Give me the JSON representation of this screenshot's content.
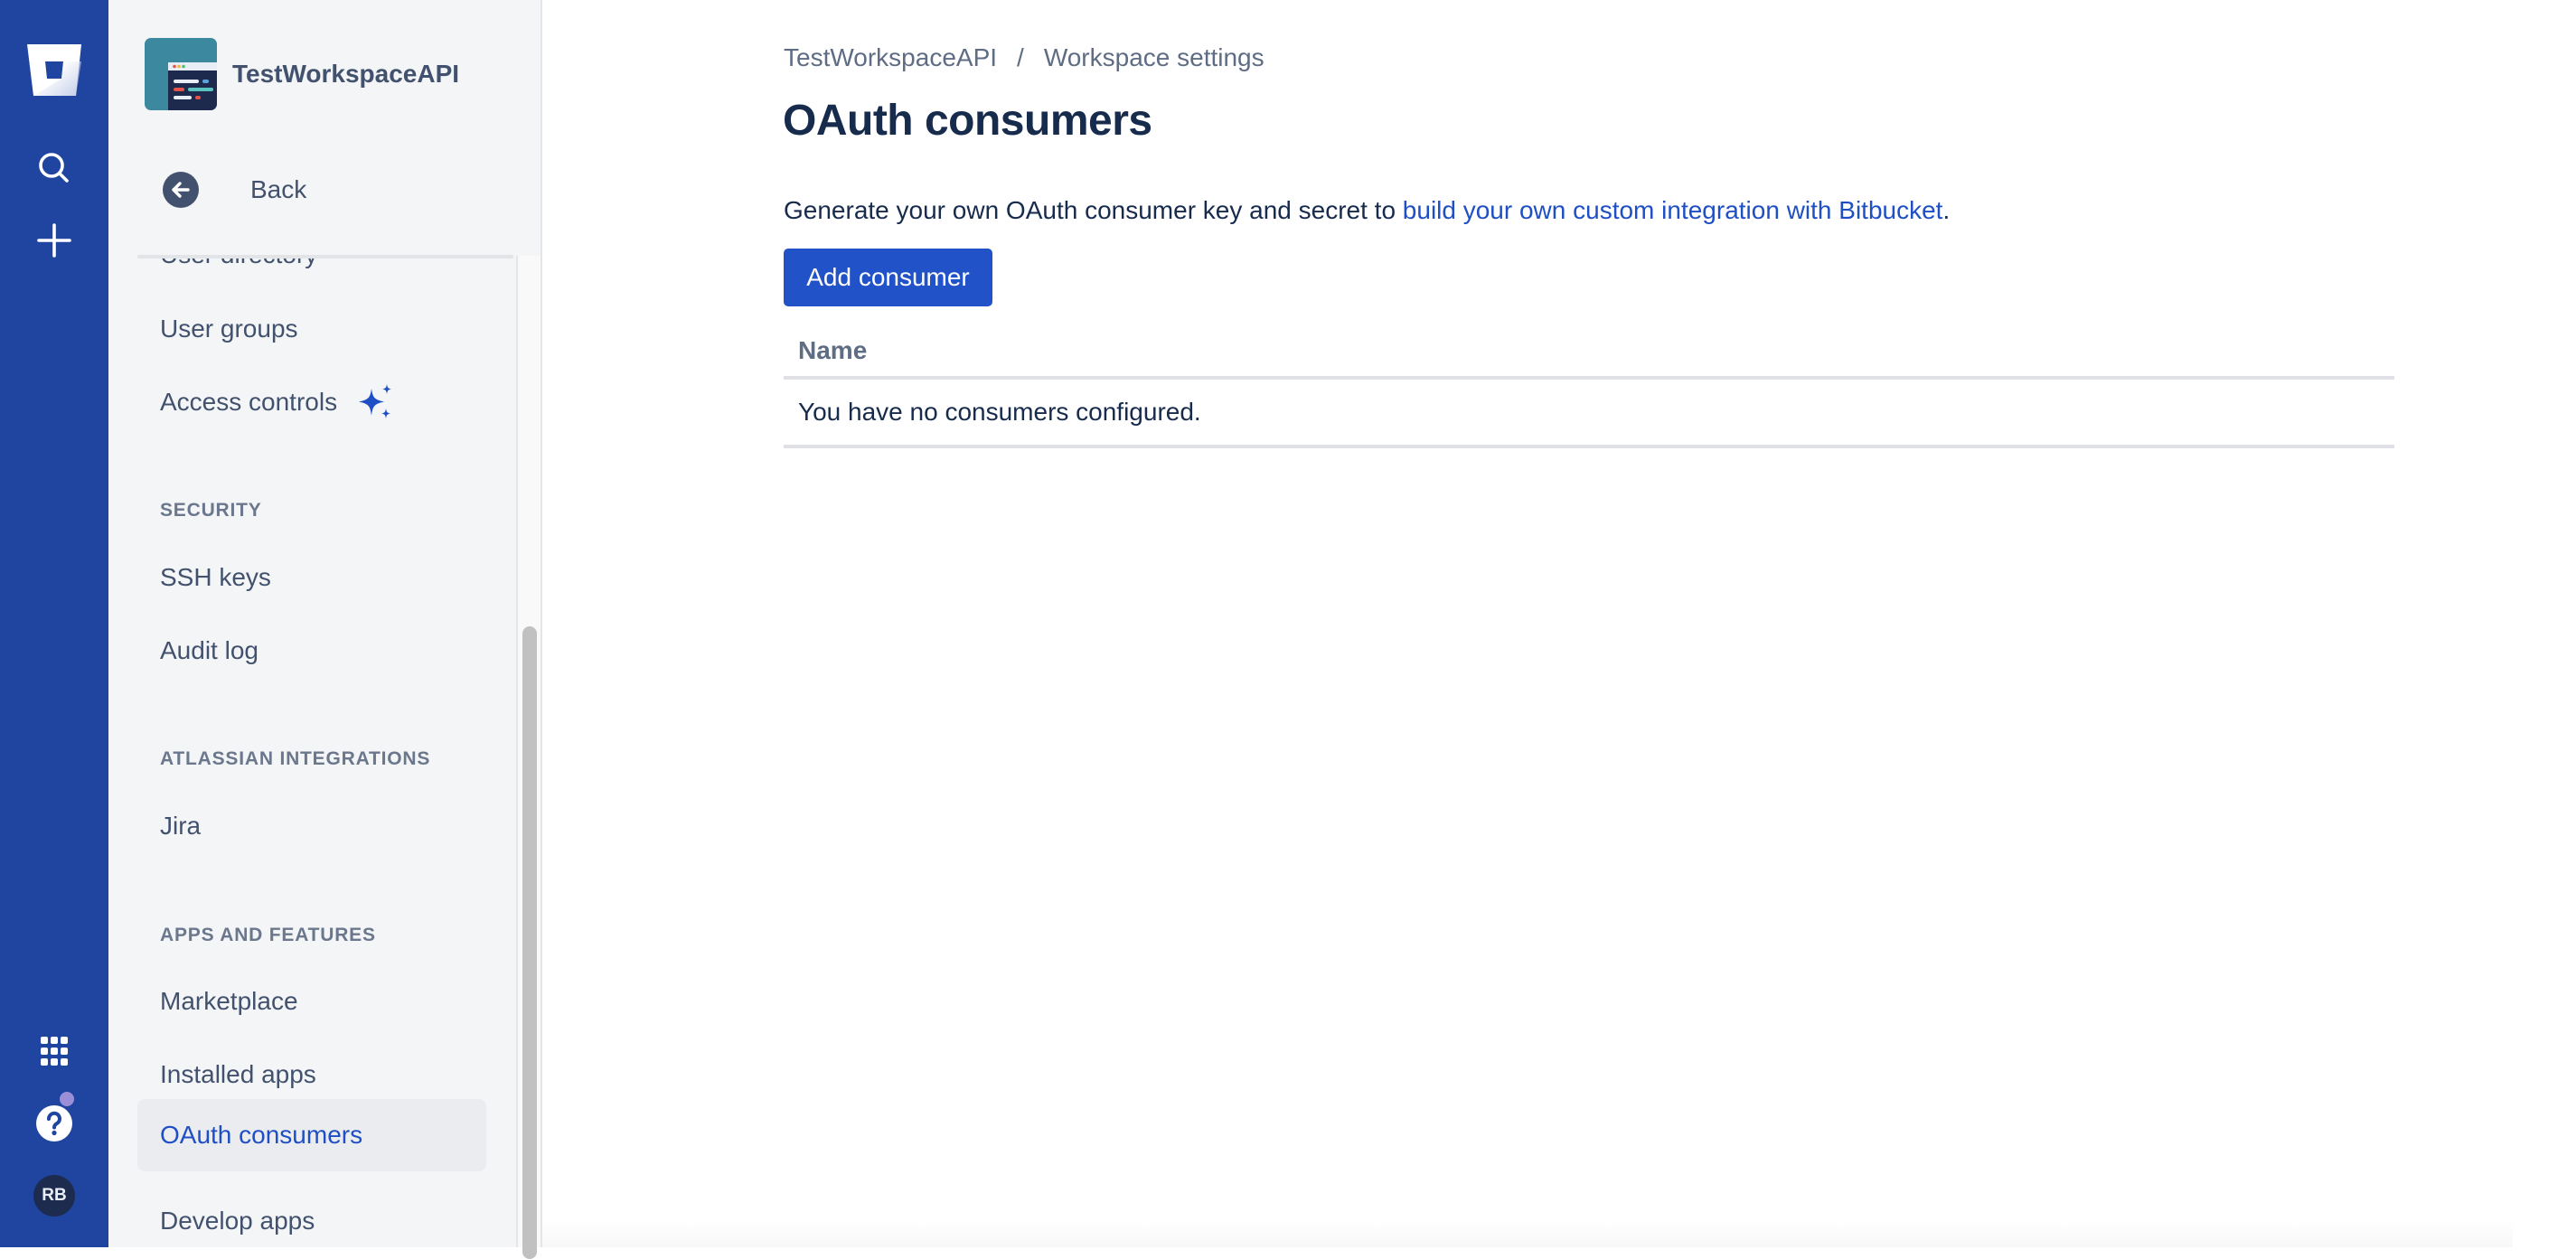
{
  "rail": {
    "icons": [
      "bitbucket-logo",
      "search-icon",
      "create-icon",
      "app-switcher-icon",
      "help-icon",
      "profile-avatar"
    ],
    "avatar_initials": "RB",
    "colors": {
      "background": "#1f45a0",
      "notification_dot": "#9b8fd8"
    }
  },
  "sidebar": {
    "workspace_name": "TestWorkspaceAPI",
    "back_label": "Back",
    "items": [
      {
        "type": "item",
        "label": "User directory"
      },
      {
        "type": "item",
        "label": "User groups"
      },
      {
        "type": "item",
        "label": "Access controls",
        "icon": "sparkle-icon"
      },
      {
        "type": "section",
        "label": "SECURITY"
      },
      {
        "type": "item",
        "label": "SSH keys"
      },
      {
        "type": "item",
        "label": "Audit log"
      },
      {
        "type": "section",
        "label": "ATLASSIAN INTEGRATIONS"
      },
      {
        "type": "item",
        "label": "Jira"
      },
      {
        "type": "section",
        "label": "APPS AND FEATURES"
      },
      {
        "type": "item",
        "label": "Marketplace"
      },
      {
        "type": "item",
        "label": "Installed apps"
      },
      {
        "type": "item",
        "label": "OAuth consumers",
        "selected": true
      },
      {
        "type": "item",
        "label": "Develop apps"
      }
    ]
  },
  "main": {
    "breadcrumb": [
      "TestWorkspaceAPI",
      "Workspace settings"
    ],
    "breadcrumb_separator": "/",
    "title": "OAuth consumers",
    "description_prefix": "Generate your own OAuth consumer key and secret to ",
    "description_link": "build your own custom integration with Bitbucket",
    "description_suffix": ".",
    "add_button_label": "Add consumer",
    "table": {
      "columns": [
        "Name"
      ],
      "empty_message": "You have no consumers configured."
    },
    "colors": {
      "primary": "#2152c7",
      "link": "#1f4fc4",
      "heading": "#172b4d"
    }
  }
}
